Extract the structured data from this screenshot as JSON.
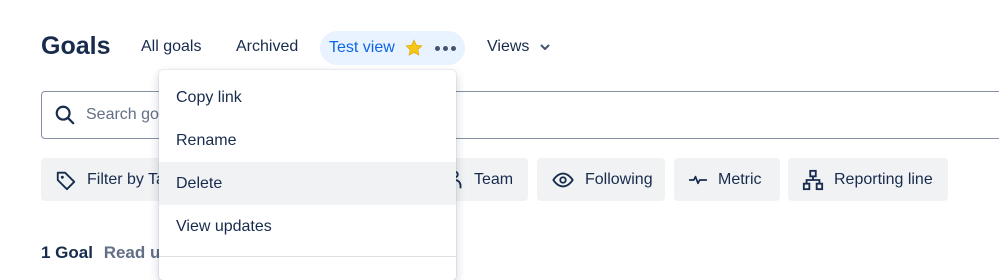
{
  "header": {
    "title": "Goals",
    "tabs": [
      {
        "label": "All goals"
      },
      {
        "label": "Archived"
      },
      {
        "label": "Test view",
        "active": true,
        "starred": true
      }
    ],
    "views_label": "Views"
  },
  "search": {
    "placeholder": "Search goa"
  },
  "filters": [
    {
      "label": "Filter by Ta",
      "icon": "tag-icon"
    },
    {
      "label": "Team",
      "icon": "people-icon"
    },
    {
      "label": "Following",
      "icon": "eye-icon"
    },
    {
      "label": "Metric",
      "icon": "pulse-icon"
    },
    {
      "label": "Reporting line",
      "icon": "hierarchy-icon"
    }
  ],
  "menu": {
    "items": [
      {
        "label": "Copy link"
      },
      {
        "label": "Rename"
      },
      {
        "label": "Delete",
        "highlighted": true
      },
      {
        "label": "View updates"
      }
    ]
  },
  "footer": {
    "count": "1 Goal",
    "link": "Read up"
  },
  "colors": {
    "accent": "#0c66e4",
    "active_tab_bg": "#e9f2ff",
    "chip_bg": "#f1f2f4",
    "star": "#f5c518"
  }
}
